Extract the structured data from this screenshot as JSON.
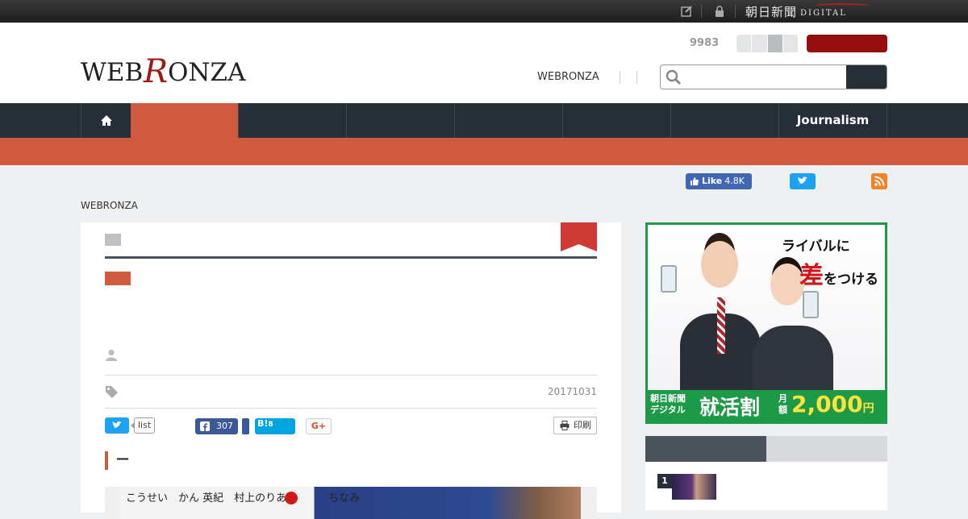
{
  "topbar": {
    "brand": "朝日新聞",
    "brand_sub": "DIGITAL",
    "icons": [
      "edit-icon",
      "lock-icon"
    ]
  },
  "header": {
    "logo_text": "WEBRONZA",
    "count": "9983",
    "nav_link": "WEBRONZA",
    "search": {
      "placeholder": "",
      "icon": "search-icon"
    }
  },
  "nav": {
    "home_icon": "home-icon",
    "last_item": "Journalism"
  },
  "social_top": {
    "fb_like": "Like",
    "fb_like_count": "4.8K",
    "icons": [
      "twitter-icon",
      "rss-icon"
    ]
  },
  "breadcrumb": "WEBRONZA",
  "article": {
    "date": "20171031",
    "share": {
      "list_label": "list",
      "fb_count": "307",
      "hatena_label": "B!",
      "hatena_count": "8",
      "gplus_label": "G+",
      "print_label": "印刷"
    },
    "heading": "—",
    "photo_caption": "こうせい　かん 英紀　村上のりあつ　　　ちなみ"
  },
  "ad": {
    "headline_1": "ライバルに",
    "headline_2_big": "差",
    "headline_2_rest": "をつける",
    "brand_line_1": "朝日新聞",
    "brand_line_2": "デジタル",
    "offer": "就活割",
    "price_label_1": "月",
    "price_label_2": "額",
    "price": "2,000",
    "price_unit": "円",
    "colors": {
      "green": "#1c9a48",
      "red": "#d0161b",
      "yellow": "#ffe23a"
    }
  },
  "ranking": {
    "items": [
      {
        "rank": "1"
      }
    ]
  },
  "colors": {
    "nav_bg": "#262e38",
    "accent": "#cf5a3e",
    "login": "#950f0f"
  }
}
